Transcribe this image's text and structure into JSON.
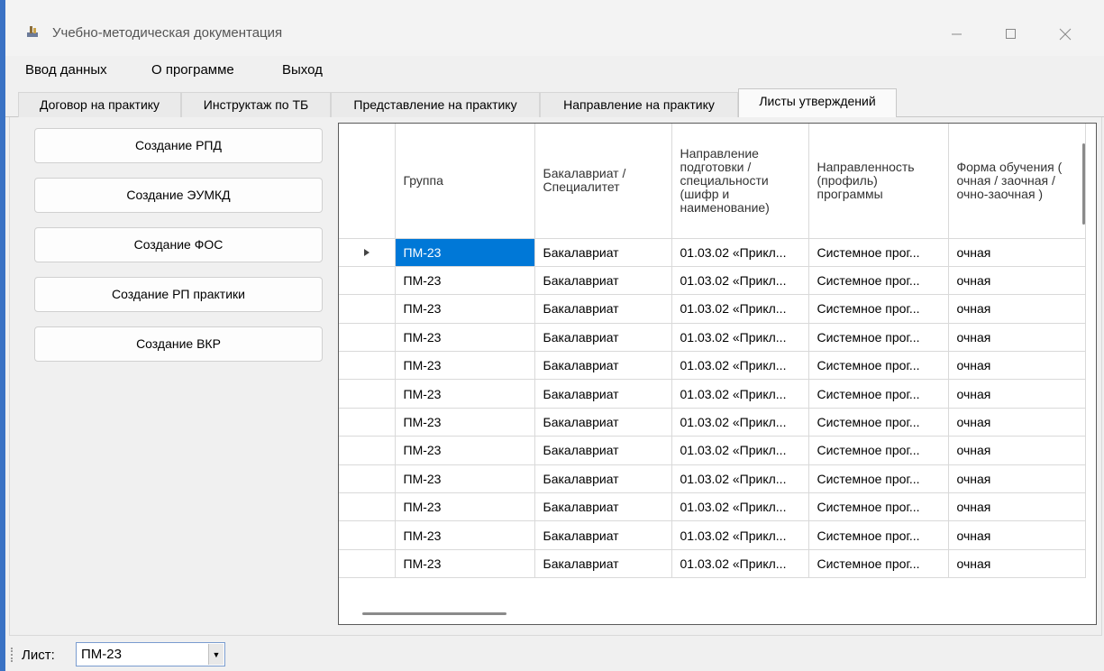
{
  "window": {
    "title": "Учебно-методическая документация"
  },
  "menu": {
    "items": [
      "Ввод данных",
      "О программе",
      "Выход"
    ]
  },
  "tabs": [
    "Договор на практику",
    "Инструктаж по ТБ",
    "Представление на практику",
    "Направление на практику",
    "Листы утверждений"
  ],
  "active_tab": "Листы утверждений",
  "side_buttons": [
    "Создание РПД",
    "Создание ЭУМКД",
    "Создание ФОС",
    "Создание РП практики",
    "Создание ВКР"
  ],
  "grid": {
    "columns": [
      "Группа",
      "Бакалавриат / Специалитет",
      "Направление подготовки / специальности (шифр и наименование)",
      "Направленность (профиль) программы",
      "Форма обучения ( очная / заочная / очно-заочная )"
    ],
    "rows": [
      [
        "ПМ-23",
        "Бакалавриат",
        "01.03.02 «Прикл...",
        "Системное прог...",
        "очная"
      ],
      [
        "ПМ-23",
        "Бакалавриат",
        "01.03.02 «Прикл...",
        "Системное прог...",
        "очная"
      ],
      [
        "ПМ-23",
        "Бакалавриат",
        "01.03.02 «Прикл...",
        "Системное прог...",
        "очная"
      ],
      [
        "ПМ-23",
        "Бакалавриат",
        "01.03.02 «Прикл...",
        "Системное прог...",
        "очная"
      ],
      [
        "ПМ-23",
        "Бакалавриат",
        "01.03.02 «Прикл...",
        "Системное прог...",
        "очная"
      ],
      [
        "ПМ-23",
        "Бакалавриат",
        "01.03.02 «Прикл...",
        "Системное прог...",
        "очная"
      ],
      [
        "ПМ-23",
        "Бакалавриат",
        "01.03.02 «Прикл...",
        "Системное прог...",
        "очная"
      ],
      [
        "ПМ-23",
        "Бакалавриат",
        "01.03.02 «Прикл...",
        "Системное прог...",
        "очная"
      ],
      [
        "ПМ-23",
        "Бакалавриат",
        "01.03.02 «Прикл...",
        "Системное прог...",
        "очная"
      ],
      [
        "ПМ-23",
        "Бакалавриат",
        "01.03.02 «Прикл...",
        "Системное прог...",
        "очная"
      ],
      [
        "ПМ-23",
        "Бакалавриат",
        "01.03.02 «Прикл...",
        "Системное прог...",
        "очная"
      ],
      [
        "ПМ-23",
        "Бакалавриат",
        "01.03.02 «Прикл...",
        "Системное прог...",
        "очная"
      ]
    ],
    "selection_color": "#0078d7"
  },
  "status": {
    "label": "Лист:",
    "selected_sheet": "ПМ-23"
  },
  "icons": {
    "app": "book-icon",
    "row_pointer": "triangle-right-icon",
    "dropdown": "chevron-down-icon"
  }
}
